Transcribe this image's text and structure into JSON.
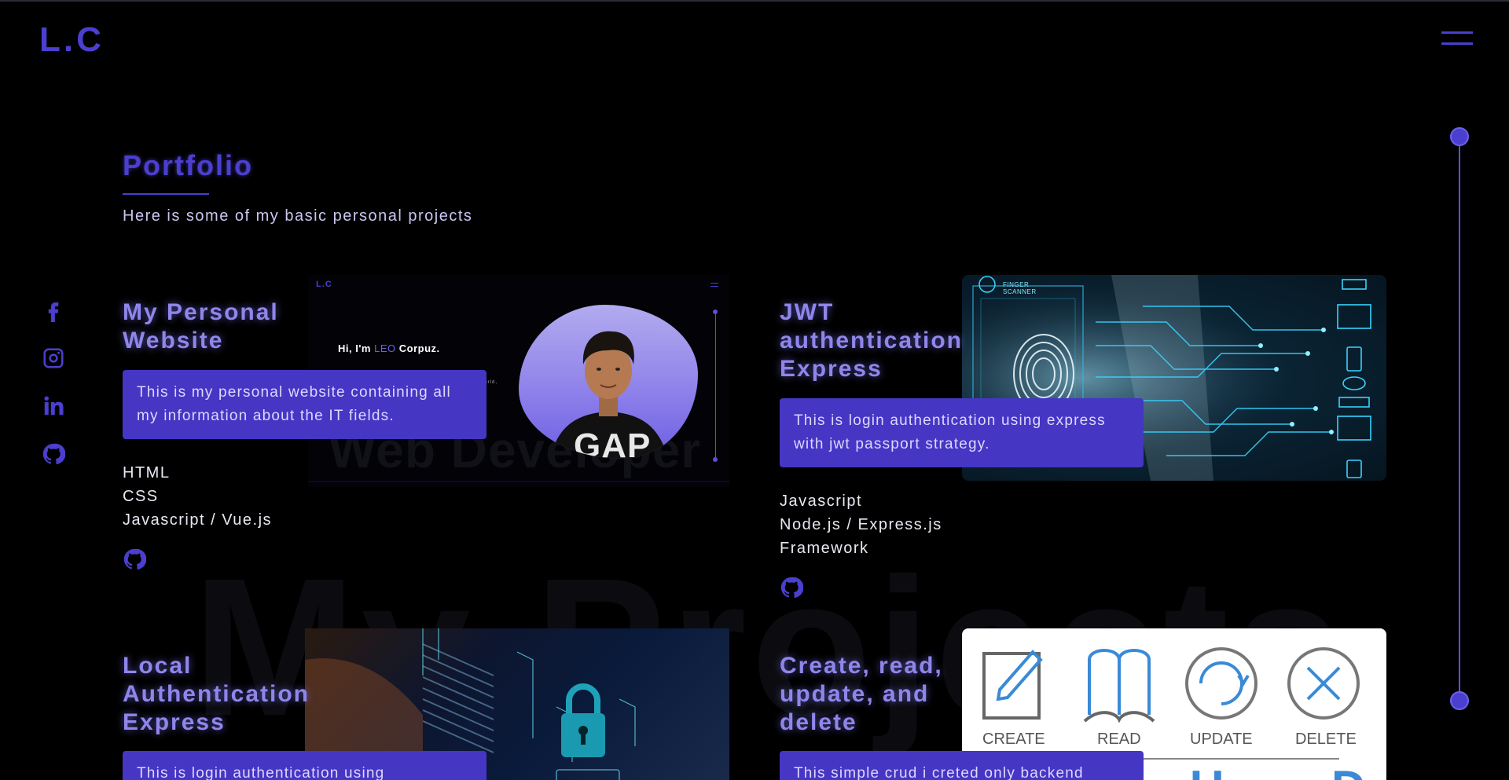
{
  "brand": {
    "logo": "L.C"
  },
  "section": {
    "title": "Portfolio",
    "subtitle": "Here is some of my basic personal projects",
    "watermark": "My Projects"
  },
  "social": [
    "facebook-icon",
    "instagram-icon",
    "linkedin-icon",
    "github-icon"
  ],
  "colors": {
    "accent": "#4b3fcf",
    "title": "#8f86ea",
    "desc_bg": "#4536c4",
    "background": "#000000"
  },
  "projects": [
    {
      "title_lines": [
        "My Personal",
        "Website"
      ],
      "description": "This is my personal website containing all my information about the IT fields.",
      "tech": [
        "HTML",
        "CSS",
        "Javascript / Vue.js"
      ],
      "preview": {
        "logo": "L.C",
        "greeting_pre": "Hi, I'm ",
        "greeting_name": "LEO",
        "greeting_post": " Corpuz.",
        "small_text": "e world,",
        "big_text": "Web Developer"
      }
    },
    {
      "title_lines": [
        "JWT",
        "authentication",
        "Express"
      ],
      "description": "This is login authentication using express with jwt passport strategy.",
      "tech": [
        "Javascript",
        "Node.js / Express.js",
        "Framework"
      ],
      "preview": {
        "label_1": "FINGER",
        "label_2": "SCANNER"
      }
    },
    {
      "title_lines": [
        "Local",
        "Authentication",
        "Express"
      ],
      "description": "This is login authentication using",
      "tech": []
    },
    {
      "title_lines": [
        "Create, read,",
        "update, and",
        "delete"
      ],
      "description": "This simple crud i creted only backend",
      "tech": [],
      "preview": {
        "labels": [
          "CREATE",
          "READ",
          "UPDATE",
          "DELETE"
        ],
        "big_letters": "U D"
      }
    }
  ]
}
